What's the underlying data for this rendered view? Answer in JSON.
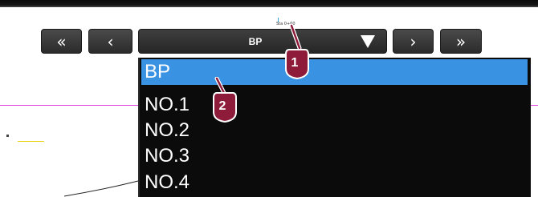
{
  "toolbar": {
    "first_label": "«",
    "prev_label": "‹",
    "next_label": "›",
    "last_label": "»",
    "tiny_label": "Sta 0+00"
  },
  "dropdown": {
    "selected": "BP",
    "arrow_icon": "caret-down-icon"
  },
  "list": {
    "items": [
      "BP",
      "NO.1",
      "NO.2",
      "NO.3",
      "NO.4"
    ],
    "selected_index": 0
  },
  "markers": [
    {
      "label": "1"
    },
    {
      "label": "2"
    }
  ],
  "colors": {
    "accent": "#3a92e2",
    "marker": "#8e1b3a",
    "panel": "#0b0b0b",
    "magenta_line": "#e040e0",
    "yellow_line": "#e8d000"
  }
}
